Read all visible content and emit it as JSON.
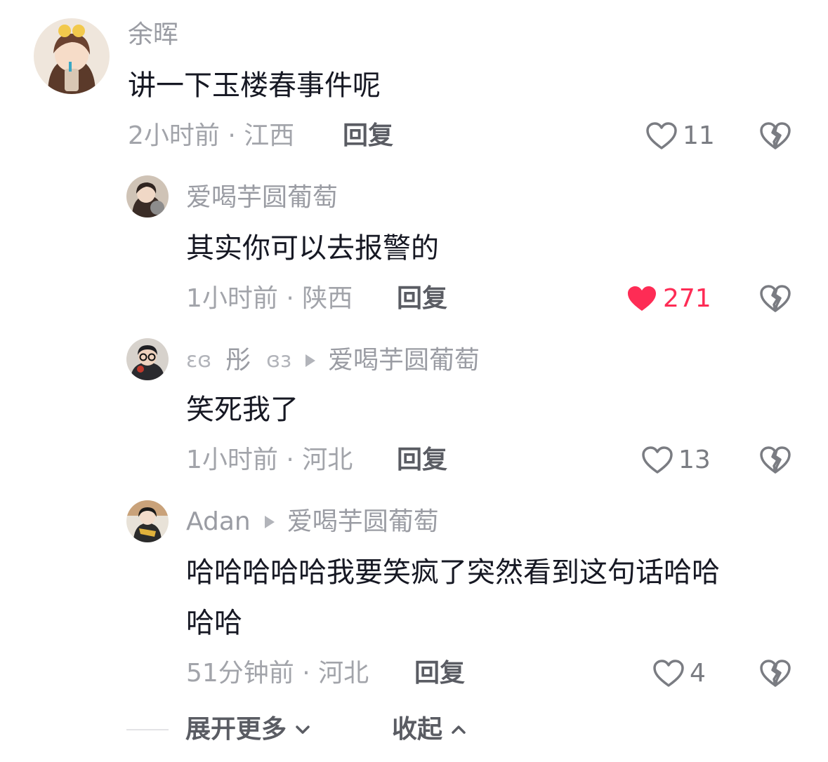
{
  "comments": [
    {
      "username": "余晖",
      "text": "讲一下玉楼春事件呢",
      "meta": "2小时前 · 江西",
      "reply_label": "回复",
      "likes": "11",
      "liked": false
    },
    {
      "username": "爱喝芋圆葡萄",
      "text": "其实你可以去报警的",
      "meta": "1小时前 · 陕西",
      "reply_label": "回复",
      "likes": "271",
      "liked": true
    },
    {
      "username_deco_left": "ɛɞ",
      "username": "彤",
      "username_deco_right": "ɞɜ",
      "reply_to": "爱喝芋圆葡萄",
      "text": "笑死我了",
      "meta": "1小时前 · 河北",
      "reply_label": "回复",
      "likes": "13",
      "liked": false
    },
    {
      "username": "Adan",
      "reply_to": "爱喝芋圆葡萄",
      "text_line1": "哈哈哈哈哈我要笑疯了突然看到这句话哈哈",
      "text_line2": "哈哈",
      "meta": "51分钟前 · 河北",
      "reply_label": "回复",
      "likes": "4",
      "liked": false
    }
  ],
  "footer": {
    "expand_label": "展开更多",
    "collapse_label": "收起"
  },
  "colors": {
    "liked_red": "#fe2c55",
    "icon_gray": "#7a7c82",
    "meta_gray": "#a2a4aa"
  },
  "icons": {
    "like": "heart-outline-icon",
    "liked": "heart-filled-icon",
    "dislike": "broken-heart-icon",
    "expand": "chevron-down-icon",
    "collapse": "chevron-up-icon",
    "reply_arrow": "play-arrow-icon"
  }
}
